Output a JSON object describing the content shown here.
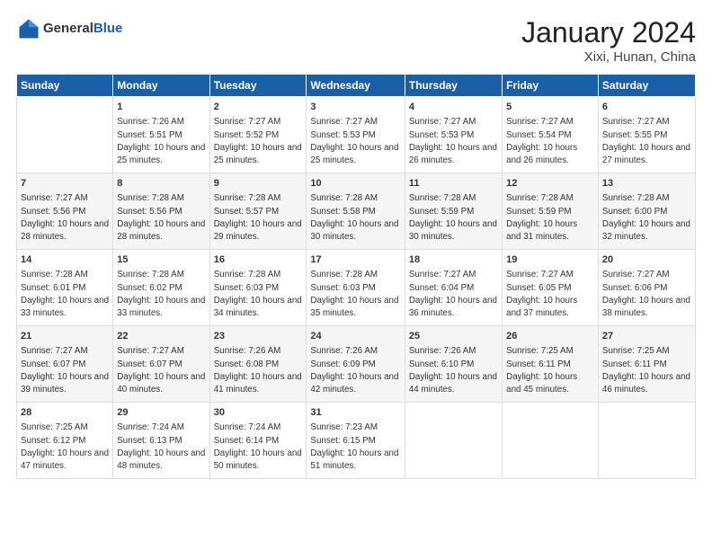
{
  "header": {
    "logo_general": "General",
    "logo_blue": "Blue",
    "month_title": "January 2024",
    "location": "Xixi, Hunan, China"
  },
  "weekdays": [
    "Sunday",
    "Monday",
    "Tuesday",
    "Wednesday",
    "Thursday",
    "Friday",
    "Saturday"
  ],
  "weeks": [
    [
      {
        "day": "",
        "sunrise": "",
        "sunset": "",
        "daylight": ""
      },
      {
        "day": "1",
        "sunrise": "Sunrise: 7:26 AM",
        "sunset": "Sunset: 5:51 PM",
        "daylight": "Daylight: 10 hours and 25 minutes."
      },
      {
        "day": "2",
        "sunrise": "Sunrise: 7:27 AM",
        "sunset": "Sunset: 5:52 PM",
        "daylight": "Daylight: 10 hours and 25 minutes."
      },
      {
        "day": "3",
        "sunrise": "Sunrise: 7:27 AM",
        "sunset": "Sunset: 5:53 PM",
        "daylight": "Daylight: 10 hours and 25 minutes."
      },
      {
        "day": "4",
        "sunrise": "Sunrise: 7:27 AM",
        "sunset": "Sunset: 5:53 PM",
        "daylight": "Daylight: 10 hours and 26 minutes."
      },
      {
        "day": "5",
        "sunrise": "Sunrise: 7:27 AM",
        "sunset": "Sunset: 5:54 PM",
        "daylight": "Daylight: 10 hours and 26 minutes."
      },
      {
        "day": "6",
        "sunrise": "Sunrise: 7:27 AM",
        "sunset": "Sunset: 5:55 PM",
        "daylight": "Daylight: 10 hours and 27 minutes."
      }
    ],
    [
      {
        "day": "7",
        "sunrise": "Sunrise: 7:27 AM",
        "sunset": "Sunset: 5:56 PM",
        "daylight": "Daylight: 10 hours and 28 minutes."
      },
      {
        "day": "8",
        "sunrise": "Sunrise: 7:28 AM",
        "sunset": "Sunset: 5:56 PM",
        "daylight": "Daylight: 10 hours and 28 minutes."
      },
      {
        "day": "9",
        "sunrise": "Sunrise: 7:28 AM",
        "sunset": "Sunset: 5:57 PM",
        "daylight": "Daylight: 10 hours and 29 minutes."
      },
      {
        "day": "10",
        "sunrise": "Sunrise: 7:28 AM",
        "sunset": "Sunset: 5:58 PM",
        "daylight": "Daylight: 10 hours and 30 minutes."
      },
      {
        "day": "11",
        "sunrise": "Sunrise: 7:28 AM",
        "sunset": "Sunset: 5:59 PM",
        "daylight": "Daylight: 10 hours and 30 minutes."
      },
      {
        "day": "12",
        "sunrise": "Sunrise: 7:28 AM",
        "sunset": "Sunset: 5:59 PM",
        "daylight": "Daylight: 10 hours and 31 minutes."
      },
      {
        "day": "13",
        "sunrise": "Sunrise: 7:28 AM",
        "sunset": "Sunset: 6:00 PM",
        "daylight": "Daylight: 10 hours and 32 minutes."
      }
    ],
    [
      {
        "day": "14",
        "sunrise": "Sunrise: 7:28 AM",
        "sunset": "Sunset: 6:01 PM",
        "daylight": "Daylight: 10 hours and 33 minutes."
      },
      {
        "day": "15",
        "sunrise": "Sunrise: 7:28 AM",
        "sunset": "Sunset: 6:02 PM",
        "daylight": "Daylight: 10 hours and 33 minutes."
      },
      {
        "day": "16",
        "sunrise": "Sunrise: 7:28 AM",
        "sunset": "Sunset: 6:03 PM",
        "daylight": "Daylight: 10 hours and 34 minutes."
      },
      {
        "day": "17",
        "sunrise": "Sunrise: 7:28 AM",
        "sunset": "Sunset: 6:03 PM",
        "daylight": "Daylight: 10 hours and 35 minutes."
      },
      {
        "day": "18",
        "sunrise": "Sunrise: 7:27 AM",
        "sunset": "Sunset: 6:04 PM",
        "daylight": "Daylight: 10 hours and 36 minutes."
      },
      {
        "day": "19",
        "sunrise": "Sunrise: 7:27 AM",
        "sunset": "Sunset: 6:05 PM",
        "daylight": "Daylight: 10 hours and 37 minutes."
      },
      {
        "day": "20",
        "sunrise": "Sunrise: 7:27 AM",
        "sunset": "Sunset: 6:06 PM",
        "daylight": "Daylight: 10 hours and 38 minutes."
      }
    ],
    [
      {
        "day": "21",
        "sunrise": "Sunrise: 7:27 AM",
        "sunset": "Sunset: 6:07 PM",
        "daylight": "Daylight: 10 hours and 39 minutes."
      },
      {
        "day": "22",
        "sunrise": "Sunrise: 7:27 AM",
        "sunset": "Sunset: 6:07 PM",
        "daylight": "Daylight: 10 hours and 40 minutes."
      },
      {
        "day": "23",
        "sunrise": "Sunrise: 7:26 AM",
        "sunset": "Sunset: 6:08 PM",
        "daylight": "Daylight: 10 hours and 41 minutes."
      },
      {
        "day": "24",
        "sunrise": "Sunrise: 7:26 AM",
        "sunset": "Sunset: 6:09 PM",
        "daylight": "Daylight: 10 hours and 42 minutes."
      },
      {
        "day": "25",
        "sunrise": "Sunrise: 7:26 AM",
        "sunset": "Sunset: 6:10 PM",
        "daylight": "Daylight: 10 hours and 44 minutes."
      },
      {
        "day": "26",
        "sunrise": "Sunrise: 7:25 AM",
        "sunset": "Sunset: 6:11 PM",
        "daylight": "Daylight: 10 hours and 45 minutes."
      },
      {
        "day": "27",
        "sunrise": "Sunrise: 7:25 AM",
        "sunset": "Sunset: 6:11 PM",
        "daylight": "Daylight: 10 hours and 46 minutes."
      }
    ],
    [
      {
        "day": "28",
        "sunrise": "Sunrise: 7:25 AM",
        "sunset": "Sunset: 6:12 PM",
        "daylight": "Daylight: 10 hours and 47 minutes."
      },
      {
        "day": "29",
        "sunrise": "Sunrise: 7:24 AM",
        "sunset": "Sunset: 6:13 PM",
        "daylight": "Daylight: 10 hours and 48 minutes."
      },
      {
        "day": "30",
        "sunrise": "Sunrise: 7:24 AM",
        "sunset": "Sunset: 6:14 PM",
        "daylight": "Daylight: 10 hours and 50 minutes."
      },
      {
        "day": "31",
        "sunrise": "Sunrise: 7:23 AM",
        "sunset": "Sunset: 6:15 PM",
        "daylight": "Daylight: 10 hours and 51 minutes."
      },
      {
        "day": "",
        "sunrise": "",
        "sunset": "",
        "daylight": ""
      },
      {
        "day": "",
        "sunrise": "",
        "sunset": "",
        "daylight": ""
      },
      {
        "day": "",
        "sunrise": "",
        "sunset": "",
        "daylight": ""
      }
    ]
  ]
}
